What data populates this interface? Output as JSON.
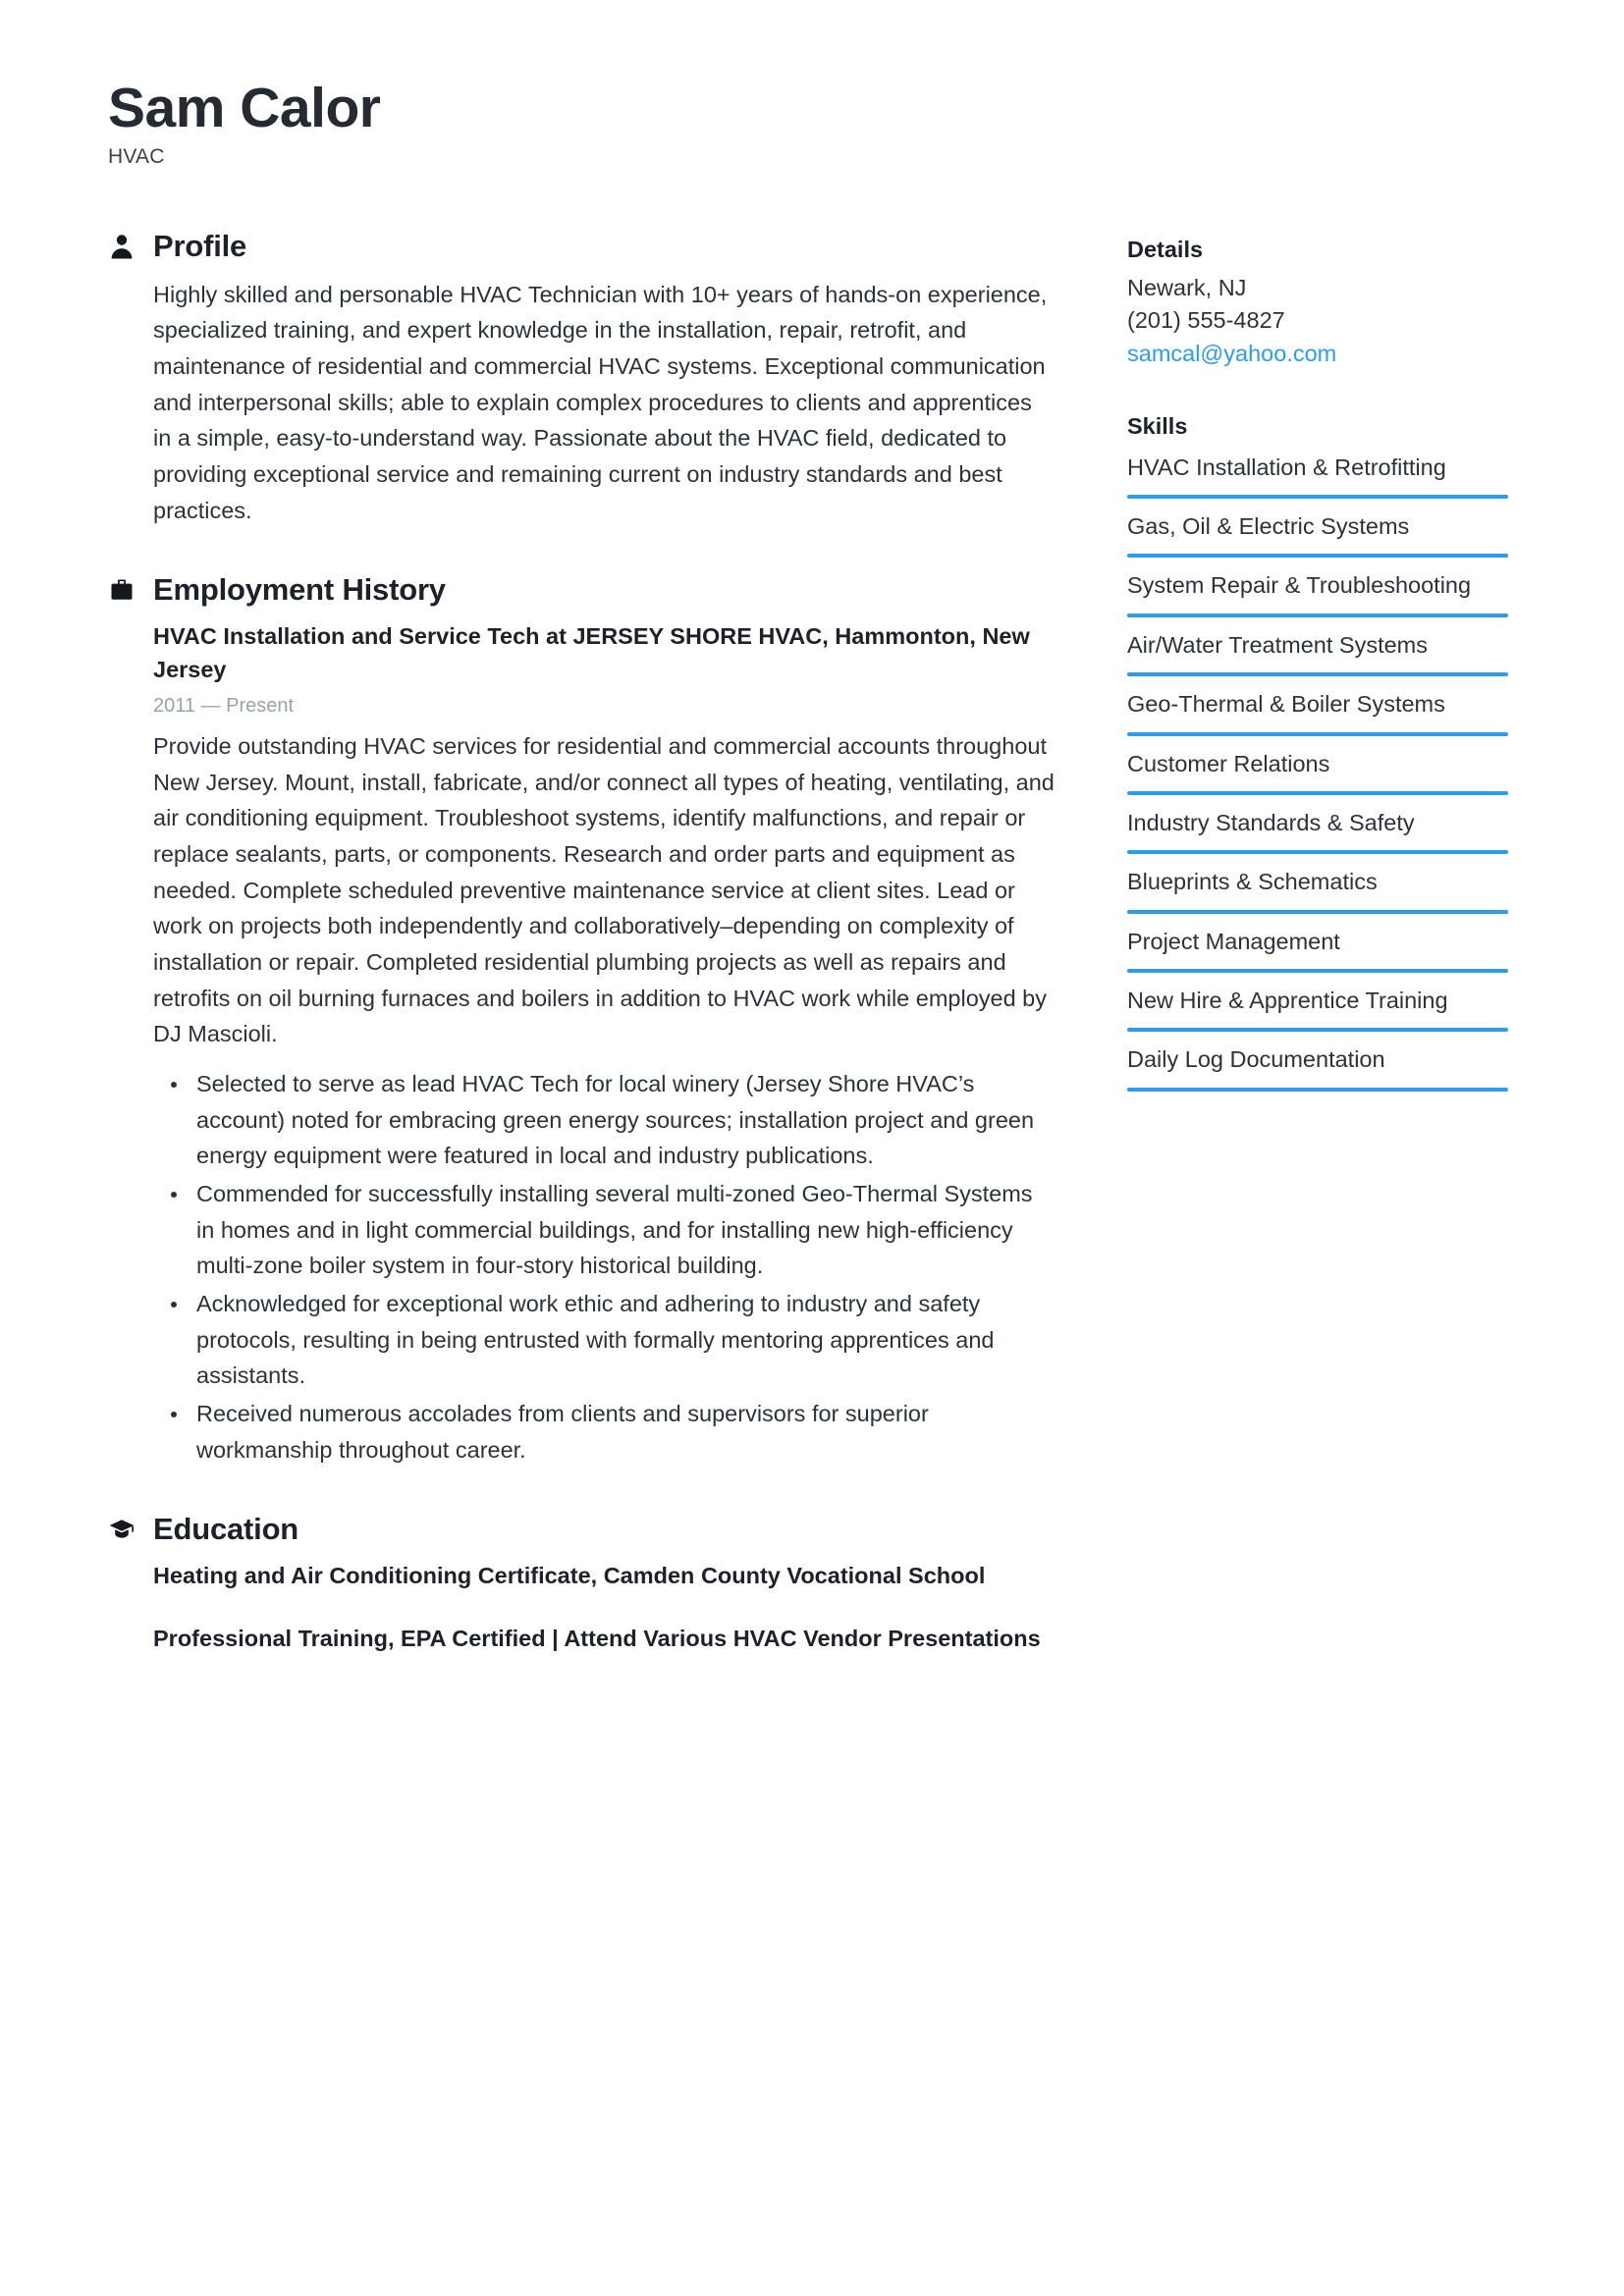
{
  "header": {
    "name": "Sam Calor",
    "title": "HVAC"
  },
  "accent_color": "#2b9cf0",
  "main": {
    "profile": {
      "icon": "person-icon",
      "heading": "Profile",
      "text": "Highly skilled and personable HVAC Technician with 10+ years of hands-on experience, specialized training, and expert knowledge in the installation, repair, retrofit, and maintenance of residential and commercial HVAC systems. Exceptional communication and interpersonal skills; able to explain complex procedures to clients and apprentices in a simple, easy-to-understand way. Passionate about the HVAC field, dedicated to providing exceptional service and remaining current on industry standards and best practices."
    },
    "employment": {
      "icon": "briefcase-icon",
      "heading": "Employment History",
      "jobs": [
        {
          "title": "HVAC Installation and Service Tech at JERSEY SHORE HVAC, Hammonton, New Jersey",
          "date": "2011 — Present",
          "description": "Provide outstanding HVAC services for residential and commercial accounts throughout New Jersey. Mount, install, fabricate, and/or connect all types of heating, ventilating, and air conditioning equipment. Troubleshoot systems, identify malfunctions, and repair or replace sealants, parts, or components. Research and order parts and equipment as needed. Complete scheduled preventive maintenance service at client sites. Lead or work on projects both independently and collaboratively–depending on complexity of installation or repair. Completed residential plumbing projects as well as repairs and retrofits on oil burning furnaces and boilers in addition to HVAC work while employed by DJ Mascioli.",
          "bullets": [
            "Selected to serve as lead HVAC Tech for local winery (Jersey Shore HVAC’s account) noted for embracing green energy sources; installation project and green energy equipment were featured in local and industry publications.",
            "Commended for successfully installing several multi-zoned Geo-Thermal Systems in homes and in light commercial buildings, and for installing new high-efficiency multi-zone boiler system in four-story historical building.",
            "Acknowledged for exceptional work ethic and adhering to industry and safety protocols, resulting in being entrusted with formally mentoring apprentices and assistants.",
            "Received numerous accolades from clients and supervisors for superior workmanship throughout career."
          ]
        }
      ]
    },
    "education": {
      "icon": "graduation-cap-icon",
      "heading": "Education",
      "entries": [
        {
          "title": "Heating and Air Conditioning Certificate, Camden County Vocational School"
        },
        {
          "title": "Professional Training, EPA Certified | Attend Various HVAC Vendor Presentations"
        }
      ]
    }
  },
  "sidebar": {
    "details": {
      "heading": "Details",
      "location": "Newark, NJ",
      "phone": "(201) 555-4827",
      "email": "samcal@yahoo.com"
    },
    "skills": {
      "heading": "Skills",
      "items": [
        "HVAC Installation & Retrofitting",
        "Gas, Oil & Electric Systems",
        "System Repair & Troubleshooting",
        "Air/Water Treatment Systems",
        "Geo-Thermal & Boiler Systems",
        "Customer Relations",
        "Industry Standards & Safety",
        "Blueprints & Schematics",
        "Project Management",
        "New Hire & Apprentice Training",
        "Daily Log Documentation"
      ]
    }
  }
}
